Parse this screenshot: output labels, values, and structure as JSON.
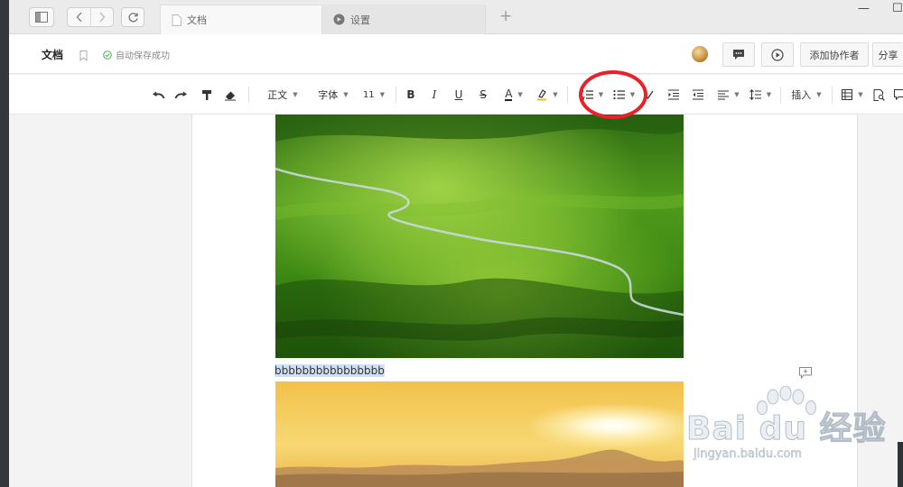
{
  "tabs": [
    {
      "label": "文档",
      "icon": "document-icon",
      "active": true
    },
    {
      "label": "设置",
      "icon": "settings-icon",
      "active": false
    }
  ],
  "header": {
    "title": "文档",
    "save_status": "自动保存成功",
    "add_collaborator_label": "添加协作者",
    "share_label": "分享"
  },
  "toolbar": {
    "paragraph_style": "正文",
    "font_family": "字体",
    "font_size": "11",
    "bold": "B",
    "italic": "I",
    "underline": "U",
    "strikethrough": "S",
    "font_color": "A",
    "insert_label": "插入"
  },
  "document": {
    "text_line": "bbbbbbbbbbbbbbbb",
    "images": [
      "green-hills-photo",
      "sunset-mountains-photo"
    ]
  },
  "watermark": {
    "brand": "Bai du 经验",
    "url": "jingyan.baidu.com"
  },
  "colors": {
    "highlight_ring": "#e8212a",
    "selection": "#cfe0f5",
    "save_ok": "#4caf50"
  }
}
